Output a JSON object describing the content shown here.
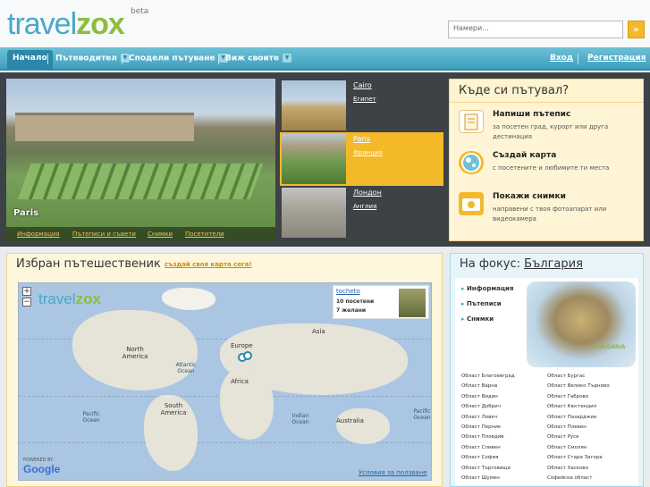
{
  "header": {
    "logo_left": "travel",
    "logo_right": "zox",
    "beta": "beta",
    "search_placeholder": "Намери...",
    "search_button": "»"
  },
  "nav": {
    "items": [
      "Начало",
      "Пътеводител",
      "Сподели пътуване",
      "Виж своите"
    ],
    "login": "Вход",
    "register": "Регистрация"
  },
  "hero": {
    "caption": "Paris",
    "links": [
      "Информация",
      "Пътеписи и съвети",
      "Снимки",
      "Посетители"
    ]
  },
  "thumbs": [
    {
      "title": "Cairo",
      "sub": "Египет"
    },
    {
      "title": "Paris",
      "sub": "Франция"
    },
    {
      "title": "Лондон",
      "sub": "Англия"
    }
  ],
  "where": {
    "heading": "Къде си пътувал?",
    "actions": [
      {
        "title": "Напиши пътепис",
        "desc": "за посетен град, курорт или друга дестинация",
        "icon": "notebook-icon"
      },
      {
        "title": "Създай карта",
        "desc": "с посетените и любимите ти места",
        "icon": "globe-icon"
      },
      {
        "title": "Покажи снимки",
        "desc": "направени с твоя фотоапарат или видеокамера",
        "icon": "camera-icon"
      }
    ]
  },
  "traveler": {
    "heading": "Избран пътешественик",
    "create_link": "създай своя карта сега!",
    "map": {
      "logo_left": "travel",
      "logo_right": "zox",
      "zoom_in": "+",
      "zoom_out": "−",
      "user": "tocheto",
      "visited": "10 посетени",
      "desired": "7 желани",
      "labels": [
        "North America",
        "Europe",
        "Asia",
        "Africa",
        "South America",
        "Australia"
      ],
      "oceans": [
        "Atlantic Ocean",
        "Pacific Ocean",
        "Indian Ocean",
        "Pacific Ocean"
      ],
      "powered": "POWERED BY",
      "google": "Google",
      "terms": "Условия за ползване"
    }
  },
  "focus": {
    "heading": "На фокус:",
    "country": "България",
    "menu": [
      "Информация",
      "Пътеписи",
      "Снимки"
    ],
    "badge": "BULGARIA",
    "regions_left": [
      "Област Благоевград",
      "Област Варна",
      "Област Видин",
      "Област Добрич",
      "Област Ловеч",
      "Област Перник",
      "Област Пловдив",
      "Област Сливен",
      "Област София",
      "Област Търговище",
      "Област Шумен"
    ],
    "regions_right": [
      "Област Бургас",
      "Област Велико Търново",
      "Област Габрово",
      "Област Кюстендил",
      "Област Пазарджик",
      "Област Плевен",
      "Област Русе",
      "Област Смолян",
      "Област Стара Загора",
      "Област Хасково",
      "Софийска област"
    ]
  },
  "colors": {
    "brand_blue": "#4aa8c8",
    "brand_green": "#8cbd3c",
    "accent_orange": "#f3b929",
    "nav_blue": "#3f9fbf"
  }
}
